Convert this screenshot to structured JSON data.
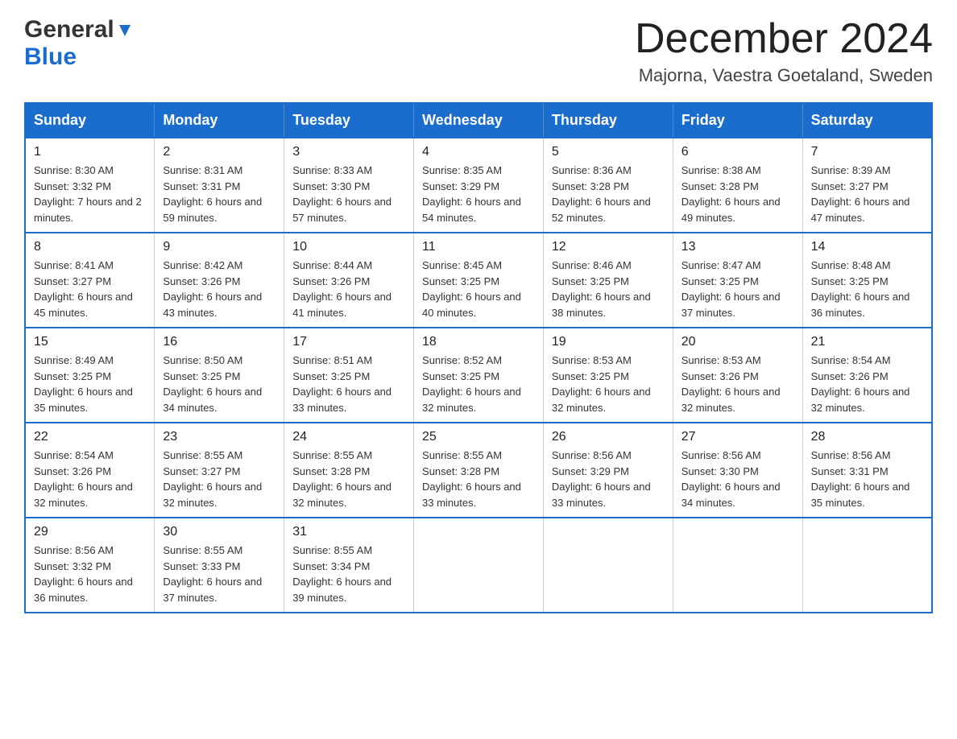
{
  "logo": {
    "general": "General",
    "blue": "Blue"
  },
  "header": {
    "month": "December 2024",
    "location": "Majorna, Vaestra Goetaland, Sweden"
  },
  "days_header": [
    "Sunday",
    "Monday",
    "Tuesday",
    "Wednesday",
    "Thursday",
    "Friday",
    "Saturday"
  ],
  "weeks": [
    [
      {
        "day": "1",
        "sunrise": "8:30 AM",
        "sunset": "3:32 PM",
        "daylight": "7 hours and 2 minutes."
      },
      {
        "day": "2",
        "sunrise": "8:31 AM",
        "sunset": "3:31 PM",
        "daylight": "6 hours and 59 minutes."
      },
      {
        "day": "3",
        "sunrise": "8:33 AM",
        "sunset": "3:30 PM",
        "daylight": "6 hours and 57 minutes."
      },
      {
        "day": "4",
        "sunrise": "8:35 AM",
        "sunset": "3:29 PM",
        "daylight": "6 hours and 54 minutes."
      },
      {
        "day": "5",
        "sunrise": "8:36 AM",
        "sunset": "3:28 PM",
        "daylight": "6 hours and 52 minutes."
      },
      {
        "day": "6",
        "sunrise": "8:38 AM",
        "sunset": "3:28 PM",
        "daylight": "6 hours and 49 minutes."
      },
      {
        "day": "7",
        "sunrise": "8:39 AM",
        "sunset": "3:27 PM",
        "daylight": "6 hours and 47 minutes."
      }
    ],
    [
      {
        "day": "8",
        "sunrise": "8:41 AM",
        "sunset": "3:27 PM",
        "daylight": "6 hours and 45 minutes."
      },
      {
        "day": "9",
        "sunrise": "8:42 AM",
        "sunset": "3:26 PM",
        "daylight": "6 hours and 43 minutes."
      },
      {
        "day": "10",
        "sunrise": "8:44 AM",
        "sunset": "3:26 PM",
        "daylight": "6 hours and 41 minutes."
      },
      {
        "day": "11",
        "sunrise": "8:45 AM",
        "sunset": "3:25 PM",
        "daylight": "6 hours and 40 minutes."
      },
      {
        "day": "12",
        "sunrise": "8:46 AM",
        "sunset": "3:25 PM",
        "daylight": "6 hours and 38 minutes."
      },
      {
        "day": "13",
        "sunrise": "8:47 AM",
        "sunset": "3:25 PM",
        "daylight": "6 hours and 37 minutes."
      },
      {
        "day": "14",
        "sunrise": "8:48 AM",
        "sunset": "3:25 PM",
        "daylight": "6 hours and 36 minutes."
      }
    ],
    [
      {
        "day": "15",
        "sunrise": "8:49 AM",
        "sunset": "3:25 PM",
        "daylight": "6 hours and 35 minutes."
      },
      {
        "day": "16",
        "sunrise": "8:50 AM",
        "sunset": "3:25 PM",
        "daylight": "6 hours and 34 minutes."
      },
      {
        "day": "17",
        "sunrise": "8:51 AM",
        "sunset": "3:25 PM",
        "daylight": "6 hours and 33 minutes."
      },
      {
        "day": "18",
        "sunrise": "8:52 AM",
        "sunset": "3:25 PM",
        "daylight": "6 hours and 32 minutes."
      },
      {
        "day": "19",
        "sunrise": "8:53 AM",
        "sunset": "3:25 PM",
        "daylight": "6 hours and 32 minutes."
      },
      {
        "day": "20",
        "sunrise": "8:53 AM",
        "sunset": "3:26 PM",
        "daylight": "6 hours and 32 minutes."
      },
      {
        "day": "21",
        "sunrise": "8:54 AM",
        "sunset": "3:26 PM",
        "daylight": "6 hours and 32 minutes."
      }
    ],
    [
      {
        "day": "22",
        "sunrise": "8:54 AM",
        "sunset": "3:26 PM",
        "daylight": "6 hours and 32 minutes."
      },
      {
        "day": "23",
        "sunrise": "8:55 AM",
        "sunset": "3:27 PM",
        "daylight": "6 hours and 32 minutes."
      },
      {
        "day": "24",
        "sunrise": "8:55 AM",
        "sunset": "3:28 PM",
        "daylight": "6 hours and 32 minutes."
      },
      {
        "day": "25",
        "sunrise": "8:55 AM",
        "sunset": "3:28 PM",
        "daylight": "6 hours and 33 minutes."
      },
      {
        "day": "26",
        "sunrise": "8:56 AM",
        "sunset": "3:29 PM",
        "daylight": "6 hours and 33 minutes."
      },
      {
        "day": "27",
        "sunrise": "8:56 AM",
        "sunset": "3:30 PM",
        "daylight": "6 hours and 34 minutes."
      },
      {
        "day": "28",
        "sunrise": "8:56 AM",
        "sunset": "3:31 PM",
        "daylight": "6 hours and 35 minutes."
      }
    ],
    [
      {
        "day": "29",
        "sunrise": "8:56 AM",
        "sunset": "3:32 PM",
        "daylight": "6 hours and 36 minutes."
      },
      {
        "day": "30",
        "sunrise": "8:55 AM",
        "sunset": "3:33 PM",
        "daylight": "6 hours and 37 minutes."
      },
      {
        "day": "31",
        "sunrise": "8:55 AM",
        "sunset": "3:34 PM",
        "daylight": "6 hours and 39 minutes."
      },
      null,
      null,
      null,
      null
    ]
  ]
}
